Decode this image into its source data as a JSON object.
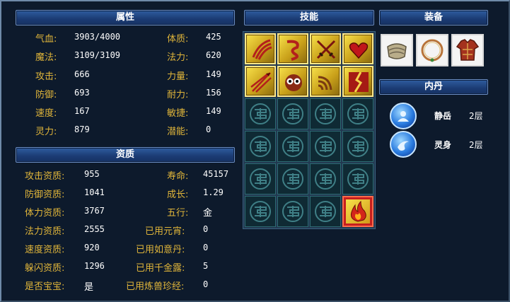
{
  "panels": {
    "attributes": {
      "title": "属性"
    },
    "aptitude": {
      "title": "资质"
    },
    "skills": {
      "title": "技能"
    },
    "equipment": {
      "title": "装备"
    },
    "neidan": {
      "title": "内丹"
    }
  },
  "attributes": {
    "left": [
      {
        "label": "气血:",
        "value": "3903/4000"
      },
      {
        "label": "魔法:",
        "value": "3109/3109"
      },
      {
        "label": "攻击:",
        "value": "666"
      },
      {
        "label": "防御:",
        "value": "693"
      },
      {
        "label": "速度:",
        "value": "167"
      },
      {
        "label": "灵力:",
        "value": "879"
      }
    ],
    "right": [
      {
        "label": "体质:",
        "value": "425"
      },
      {
        "label": "法力:",
        "value": "620"
      },
      {
        "label": "力量:",
        "value": "149"
      },
      {
        "label": "耐力:",
        "value": "156"
      },
      {
        "label": "敏捷:",
        "value": "149"
      },
      {
        "label": "潜能:",
        "value": "0"
      }
    ]
  },
  "aptitude": {
    "left": [
      {
        "label": "攻击资质:",
        "value": "955"
      },
      {
        "label": "防御资质:",
        "value": "1041"
      },
      {
        "label": "体力资质:",
        "value": "3767"
      },
      {
        "label": "法力资质:",
        "value": "2555"
      },
      {
        "label": "速度资质:",
        "value": "920"
      },
      {
        "label": "躲闪资质:",
        "value": "1296"
      },
      {
        "label": "是否宝宝:",
        "value": "是"
      }
    ],
    "right": [
      {
        "label": "寿命:",
        "value": "45157"
      },
      {
        "label": "成长:",
        "value": "1.29"
      },
      {
        "label": "五行:",
        "value": "金"
      },
      {
        "label": "已用元宵:",
        "value": "0"
      },
      {
        "label": "已用如意丹:",
        "value": "0"
      },
      {
        "label": "已用千金露:",
        "value": "5"
      },
      {
        "label": "已用炼兽珍经:",
        "value": "0"
      }
    ]
  },
  "skills": {
    "icons": [
      "claw-slash-icon",
      "red-sash-icon",
      "crossed-swords-icon",
      "heart-icon",
      "triple-spear-icon",
      "owl-face-icon",
      "signal-wave-icon",
      "red-crack-icon"
    ],
    "last_icon": "fire-icon",
    "empty_count": 15
  },
  "equipment": {
    "items": [
      "bracer-icon",
      "ring-necklace-icon",
      "armor-icon"
    ]
  },
  "neidan": {
    "items": [
      {
        "name": "静岳",
        "level": "2层",
        "icon": "blue-orb-icon"
      },
      {
        "name": "灵身",
        "level": "2层",
        "icon": "blue-orb-icon"
      }
    ]
  },
  "colors": {
    "label": "#e0b53a",
    "value": "#ffffff",
    "header": "#1b3b73",
    "bg": "#0d1a2c"
  }
}
